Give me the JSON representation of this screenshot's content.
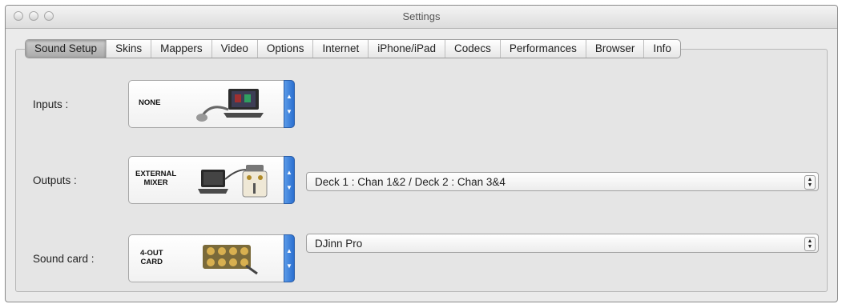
{
  "window": {
    "title": "Settings"
  },
  "tabs": [
    {
      "label": "Sound Setup",
      "selected": true
    },
    {
      "label": "Skins"
    },
    {
      "label": "Mappers"
    },
    {
      "label": "Video"
    },
    {
      "label": "Options"
    },
    {
      "label": "Internet"
    },
    {
      "label": "iPhone/iPad"
    },
    {
      "label": "Codecs"
    },
    {
      "label": "Performances"
    },
    {
      "label": "Browser"
    },
    {
      "label": "Info"
    }
  ],
  "inputs": {
    "label": "Inputs :",
    "value": "NONE"
  },
  "outputs": {
    "label": "Outputs :",
    "value_line1": "EXTERNAL",
    "value_line2": "MIXER",
    "routing": "Deck 1 : Chan 1&2 / Deck 2 : Chan 3&4"
  },
  "soundcard": {
    "label": "Sound card :",
    "value_line1": "4-OUT",
    "value_line2": "CARD",
    "device": "DJinn Pro"
  },
  "colors": {
    "accent": "#2a6fd0",
    "panel": "#e5e5e5"
  }
}
